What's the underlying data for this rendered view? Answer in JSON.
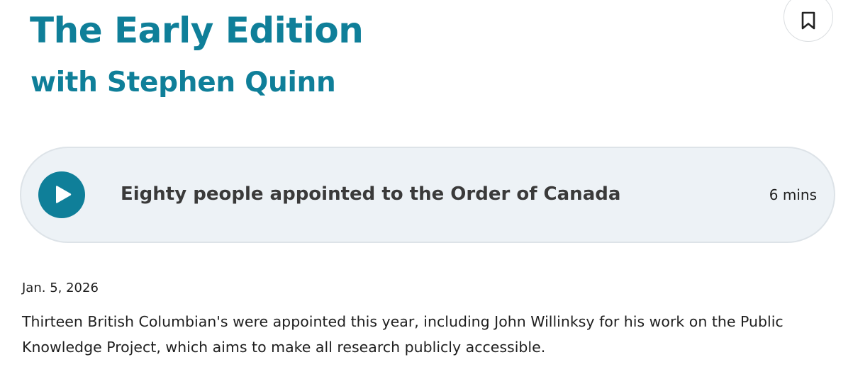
{
  "show": {
    "title": "The Early Edition",
    "host": "with Stephen Quinn"
  },
  "bookmark": {
    "icon": "bookmark-icon"
  },
  "player": {
    "play_icon": "play-icon",
    "episode_title": "Eighty people appointed to the Order of Canada",
    "duration": "6 mins",
    "accent_color": "#0f7f99",
    "background_color": "#edf2f6"
  },
  "episode": {
    "date": "Jan. 5, 2026",
    "description": "Thirteen British Columbian's were appointed this year, including John Willinksy for his work on the Public Knowledge Project, which aims to make all research publicly accessible."
  }
}
